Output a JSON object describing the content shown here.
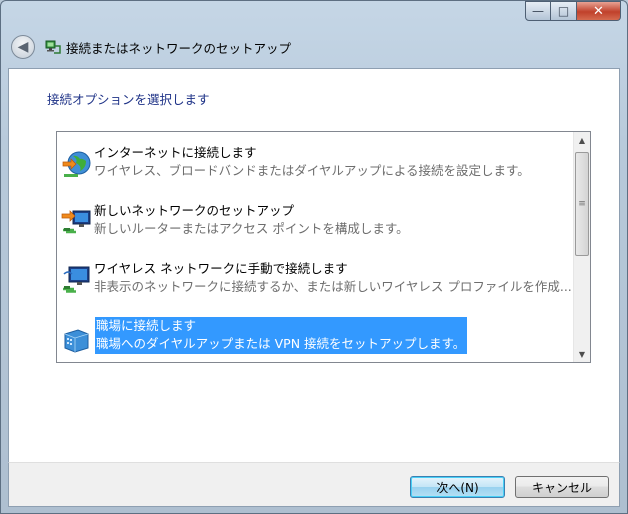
{
  "window": {
    "title": "接続またはネットワークのセットアップ",
    "controls": {
      "minimize": "—",
      "maximize": "□",
      "close": "✕"
    }
  },
  "heading": "接続オプションを選択します",
  "options": [
    {
      "title": "インターネットに接続します",
      "desc": "ワイヤレス、ブロードバンドまたはダイヤルアップによる接続を設定します。",
      "icon": "globe-network-icon",
      "selected": false
    },
    {
      "title": "新しいネットワークのセットアップ",
      "desc": "新しいルーターまたはアクセス ポイントを構成します。",
      "icon": "router-setup-icon",
      "selected": false
    },
    {
      "title": "ワイヤレス ネットワークに手動で接続します",
      "desc": "非表示のネットワークに接続するか、または新しいワイヤレス プロファイルを作成...",
      "icon": "wireless-network-icon",
      "selected": false
    },
    {
      "title": "職場に接続します",
      "desc": "職場へのダイヤルアップまたは VPN 接続をセットアップします。",
      "icon": "workplace-icon",
      "selected": true
    }
  ],
  "buttons": {
    "next": "次へ(N)",
    "cancel": "キャンセル"
  },
  "colors": {
    "selection": "#3399ff",
    "heading": "#1e3287"
  }
}
